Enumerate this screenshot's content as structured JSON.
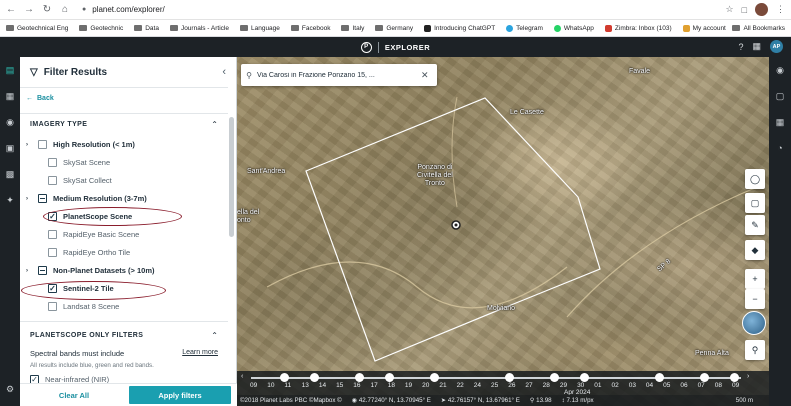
{
  "browser": {
    "url": "planet.com/explorer/",
    "bookmarks": [
      {
        "label": "Geotechnical Eng",
        "kind": "folder"
      },
      {
        "label": "Geotechnic",
        "kind": "folder"
      },
      {
        "label": "Data",
        "kind": "folder"
      },
      {
        "label": "Journals - Article",
        "kind": "folder"
      },
      {
        "label": "Language",
        "kind": "folder"
      },
      {
        "label": "Facebook",
        "kind": "folder"
      },
      {
        "label": "Italy",
        "kind": "folder"
      },
      {
        "label": "Germany",
        "kind": "folder"
      },
      {
        "label": "Introducing ChatGPT",
        "kind": "site",
        "color": "#222222"
      },
      {
        "label": "Telegram",
        "kind": "site",
        "color": "#2aa3de"
      },
      {
        "label": "WhatsApp",
        "kind": "site",
        "color": "#25d366"
      },
      {
        "label": "Zimbra: Inbox (103)",
        "kind": "site",
        "color": "#d13b2f"
      },
      {
        "label": "My account",
        "kind": "site",
        "color": "#e0a030"
      }
    ],
    "all_bookmarks": "All Bookmarks"
  },
  "app": {
    "logo": "P",
    "title": "EXPLORER",
    "user_initials": "AP"
  },
  "panel": {
    "title": "Filter Results",
    "back": "Back",
    "imagery_type": {
      "header": "IMAGERY TYPE",
      "groups": [
        {
          "label": "High Resolution (< 1m)",
          "state": "unchecked",
          "items": [
            {
              "label": "SkySat Scene",
              "checked": false
            },
            {
              "label": "SkySat Collect",
              "checked": false
            }
          ]
        },
        {
          "label": "Medium Resolution (3-7m)",
          "state": "partial",
          "items": [
            {
              "label": "PlanetScope Scene",
              "checked": true
            },
            {
              "label": "RapidEye Basic Scene",
              "checked": false
            },
            {
              "label": "RapidEye Ortho Tile",
              "checked": false
            }
          ]
        },
        {
          "label": "Non-Planet Datasets (> 10m)",
          "state": "partial",
          "items": [
            {
              "label": "Sentinel-2 Tile",
              "checked": true
            },
            {
              "label": "Landsat 8 Scene",
              "checked": false
            }
          ]
        }
      ]
    },
    "planetscope": {
      "header": "PLANETSCOPE ONLY FILTERS",
      "spectral_label": "Spectral bands must include",
      "learn_more": "Learn more",
      "note": "All results include blue, green and red bands.",
      "nir_label": "Near-infrared (NIR)"
    },
    "clear_all": "Clear All",
    "apply": "Apply filters"
  },
  "map": {
    "search_value": "Via Carosi in Frazione Ponzano 15, ...",
    "places": [
      {
        "label": "Favale"
      },
      {
        "label": "Le Casette"
      },
      {
        "label": "Ponzano di\nCivitella del\nTronto"
      },
      {
        "label": "Sant'Andrea"
      },
      {
        "label": "ella del\nonto"
      },
      {
        "label": "Molviano"
      },
      {
        "label": "Penna Alta"
      },
      {
        "label": "SP 8"
      }
    ],
    "timeline": {
      "ticks": [
        "09",
        "10",
        "11",
        "13",
        "14",
        "15",
        "16",
        "17",
        "18",
        "19",
        "20",
        "21",
        "22",
        "24",
        "25",
        "26",
        "27",
        "28",
        "29",
        "30",
        "01",
        "02",
        "03",
        "04",
        "05",
        "06",
        "07",
        "08",
        "09"
      ],
      "month": "Apr 2024"
    },
    "status": {
      "copyright": "©2018 Planet Labs PBC ©Mapbox ©",
      "coord1": "42.77240° N, 13.70945° E",
      "coord2": "42.76157° N, 13.67961° E",
      "zoom": "13.98",
      "res": "7.13 m/px",
      "scale": "500 m"
    }
  }
}
